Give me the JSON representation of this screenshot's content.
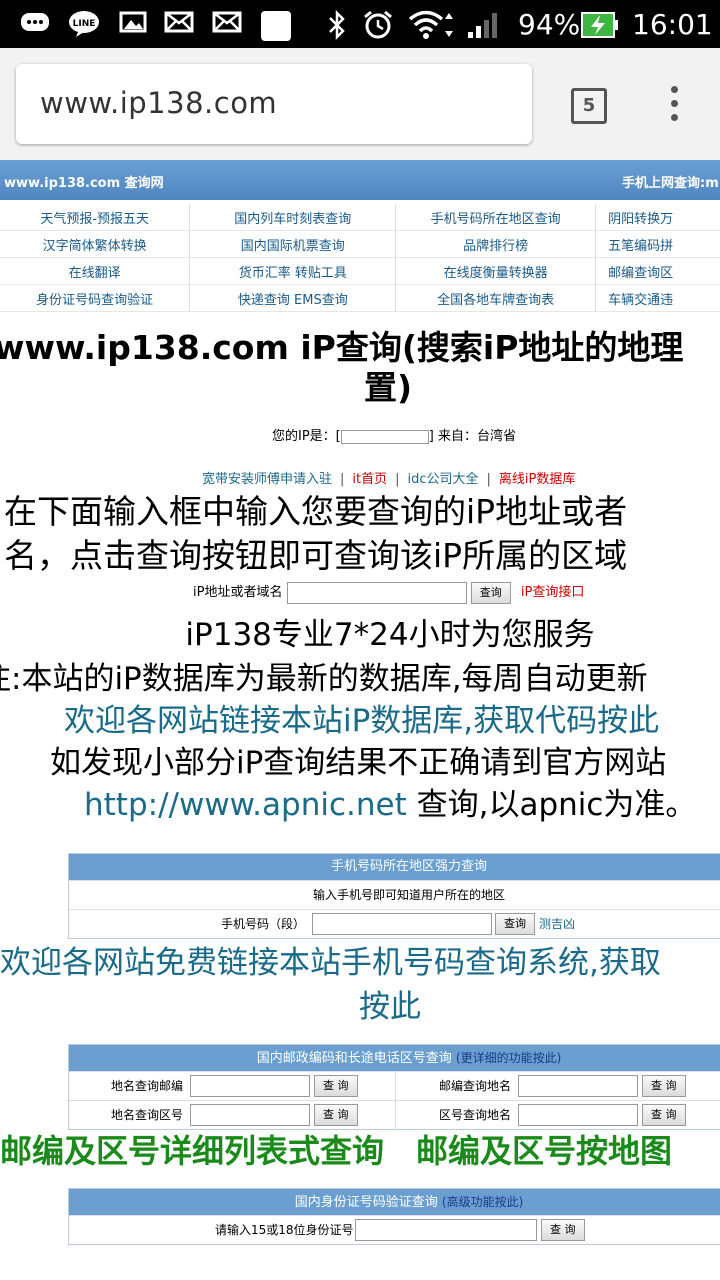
{
  "status_bar": {
    "icons_left": [
      "chat-icon",
      "line-icon",
      "image-icon",
      "mail-icon",
      "mail-icon",
      "blank-card-icon"
    ],
    "battery": "94%",
    "time": "16:01"
  },
  "browser": {
    "url": "www.ip138.com",
    "tab_count": "5"
  },
  "site": {
    "header_left": "www.ip138.com 查询网",
    "header_right": "手机上网查询:m",
    "nav_rows": [
      [
        "天气预报-预报五天",
        "国内列车时刻表查询",
        "手机号码所在地区查询",
        "阴阳转换万"
      ],
      [
        "汉字简体繁体转换",
        "国内国际机票查询",
        "品牌排行榜",
        "五笔编码拼"
      ],
      [
        "在线翻译",
        "货币汇率 转贴工具",
        "在线度衡量转换器",
        "邮编查询区"
      ],
      [
        "身份证号码查询验证",
        "快递查询 EMS查询",
        "全国各地车牌查询表",
        "车辆交通违"
      ]
    ],
    "title_line1": "www.ip138.com iP查询(搜索iP地址的地理",
    "title_line2": "置)",
    "ip_label": "您的IP是：[",
    "ip_suffix": "] 来自：台湾省",
    "links": [
      "宽带安装师傅申请入驻",
      "it首页",
      "idc公司大全",
      "离线iP数据库"
    ],
    "instruction_line1": "在下面输入框中输入您要查询的iP地址或者",
    "instruction_line2": "名，点击查询按钮即可查询该iP所属的区域",
    "search_label": "iP地址或者域名",
    "search_button": "查询",
    "search_api": "iP查询接口",
    "service": "iP138专业7*24小时为您服务",
    "note": "注:本站的iP数据库为最新的数据库,每周自动更新",
    "welcome_link": "欢迎各网站链接本站iP数据库,获取代码按此",
    "notice": "如发现小部分iP查询结果不正确请到官方网站",
    "apnic_url": "http://www.apnic.net",
    "apnic_suffix": " 查询,以apnic为准。",
    "phone_box": {
      "head": "手机号码所在地区强力查询",
      "desc": "输入手机号即可知道用户所在的地区",
      "label": "手机号码（段）",
      "button": "查询",
      "extra": "测吉凶"
    },
    "phone_welcome_1": "欢迎各网站免费链接本站手机号码查询系统,获取",
    "phone_welcome_2": "按此",
    "postal_box": {
      "head": "国内邮政编码和长途电话区号查询",
      "head_sub": "(更详细的功能按此)",
      "r1_left_label": "地名查询邮编",
      "r1_right_label": "邮编查询地名",
      "r2_left_label": "地名查询区号",
      "r2_right_label": "区号查询地名",
      "button": "查 询"
    },
    "postal_links": "邮编及区号详细列表式查询　邮编及区号按地图",
    "id_box": {
      "head": "国内身份证号码验证查询",
      "head_sub": "(高级功能按此)",
      "label": "请输入15或18位身份证号",
      "button": "查 询"
    }
  }
}
